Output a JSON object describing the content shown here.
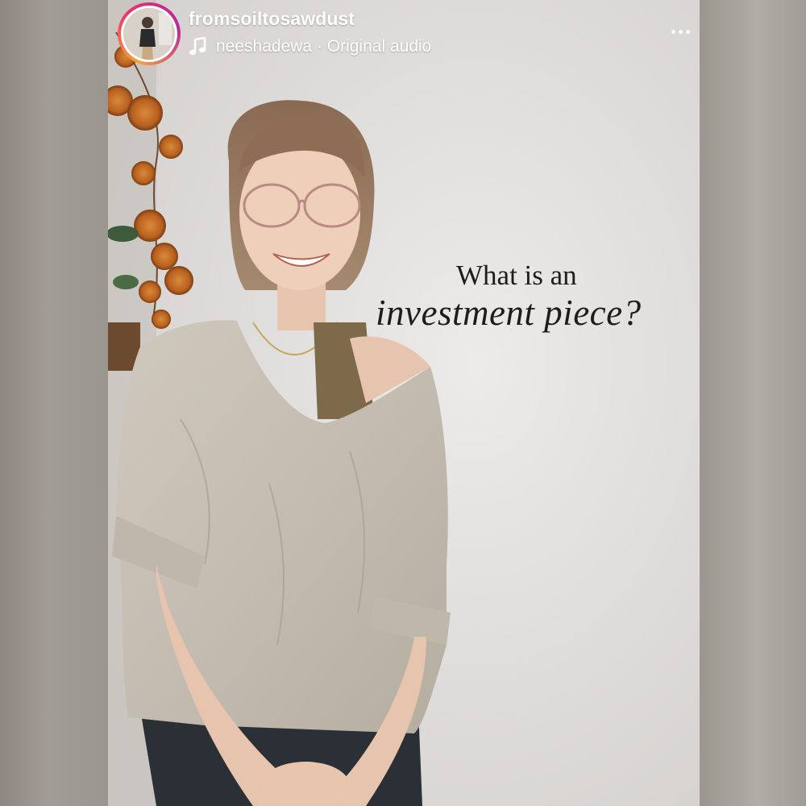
{
  "post": {
    "username": "fromsoiltosawdust",
    "audio_label": "neeshadewa · Original audio"
  },
  "caption": {
    "line1": "What is an",
    "line2": "investment piece?"
  },
  "icons": {
    "audio": "music-note-icon",
    "menu": "more-options-icon"
  },
  "colors": {
    "avatar_ring": [
      "#f9a23b",
      "#e8306e",
      "#b7279f"
    ],
    "header_text": "#ffffff",
    "caption_text": "#1d1d1d"
  }
}
